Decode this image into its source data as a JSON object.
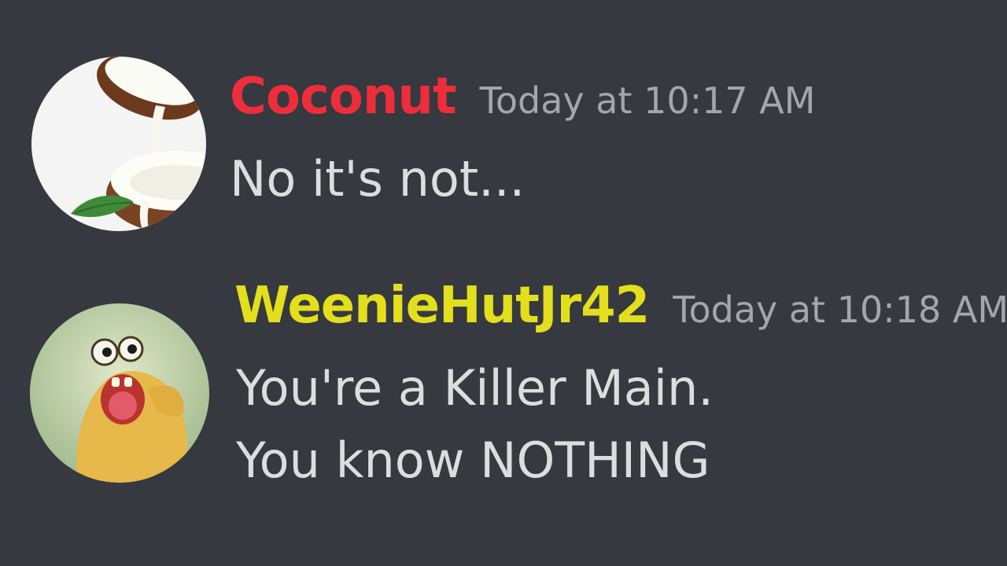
{
  "colors": {
    "background": "#36393f",
    "timestamp": "#a3a6ab",
    "message_text": "#dcddde"
  },
  "messages": [
    {
      "username": "Coconut",
      "username_color": "#ed2e3a",
      "timestamp": "Today at 10:17 AM",
      "avatar_icon": "coconut-avatar",
      "lines": [
        "No it's not..."
      ]
    },
    {
      "username": "WeenieHutJr42",
      "username_color": "#e3df1c",
      "timestamp": "Today at 10:18 AM",
      "avatar_icon": "creature-avatar",
      "lines": [
        "You're a Killer Main.",
        "You know NOTHING"
      ]
    }
  ]
}
